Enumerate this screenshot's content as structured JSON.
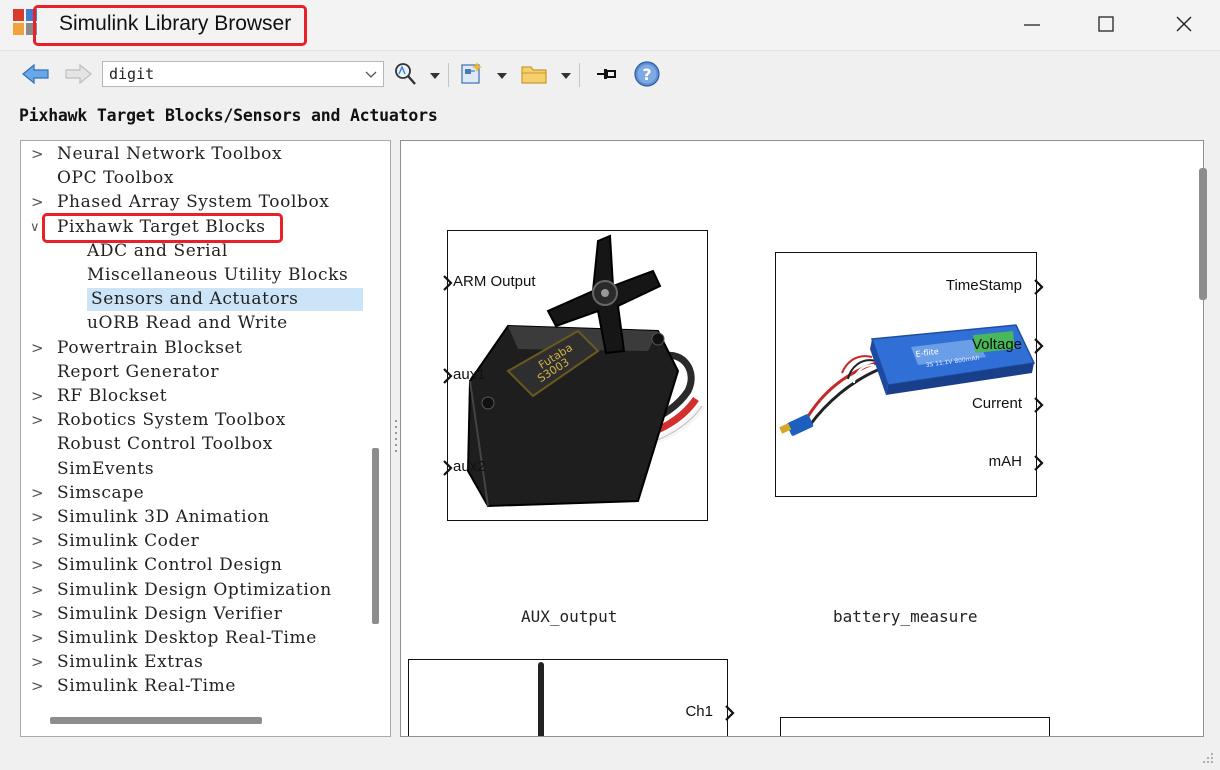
{
  "window": {
    "title": "Simulink Library Browser"
  },
  "toolbar": {
    "search_value": "digit"
  },
  "breadcrumb": "Pixhawk Target Blocks/Sensors and Actuators",
  "tree": {
    "items": [
      {
        "label": "Neural Network Toolbox",
        "arrow": ">"
      },
      {
        "label": "OPC Toolbox",
        "arrow": ""
      },
      {
        "label": "Phased Array System Toolbox",
        "arrow": ">"
      },
      {
        "label": "Pixhawk Target Blocks",
        "arrow": "v"
      },
      {
        "label": "ADC and Serial",
        "arrow": ""
      },
      {
        "label": "Miscellaneous Utility Blocks",
        "arrow": ""
      },
      {
        "label": "Sensors and Actuators",
        "arrow": ""
      },
      {
        "label": "uORB Read and Write",
        "arrow": ""
      },
      {
        "label": "Powertrain Blockset",
        "arrow": ">"
      },
      {
        "label": "Report Generator",
        "arrow": ""
      },
      {
        "label": "RF Blockset",
        "arrow": ">"
      },
      {
        "label": "Robotics System Toolbox",
        "arrow": ">"
      },
      {
        "label": "Robust Control Toolbox",
        "arrow": ""
      },
      {
        "label": "SimEvents",
        "arrow": ""
      },
      {
        "label": "Simscape",
        "arrow": ">"
      },
      {
        "label": "Simulink 3D Animation",
        "arrow": ">"
      },
      {
        "label": "Simulink Coder",
        "arrow": ">"
      },
      {
        "label": "Simulink Control Design",
        "arrow": ">"
      },
      {
        "label": "Simulink Design Optimization",
        "arrow": ">"
      },
      {
        "label": "Simulink Design Verifier",
        "arrow": ">"
      },
      {
        "label": "Simulink Desktop Real-Time",
        "arrow": ">"
      },
      {
        "label": "Simulink Extras",
        "arrow": ">"
      },
      {
        "label": "Simulink Real-Time",
        "arrow": ">"
      }
    ]
  },
  "blocks": {
    "aux_output": {
      "name": "AUX_output",
      "inputs": [
        "ARM Output",
        "aux1",
        "aux2"
      ]
    },
    "battery_measure": {
      "name": "battery_measure",
      "outputs": [
        "TimeStamp",
        "Voltage",
        "Current",
        "mAH"
      ]
    },
    "third_block": {
      "outputs": [
        "Ch1"
      ]
    }
  }
}
